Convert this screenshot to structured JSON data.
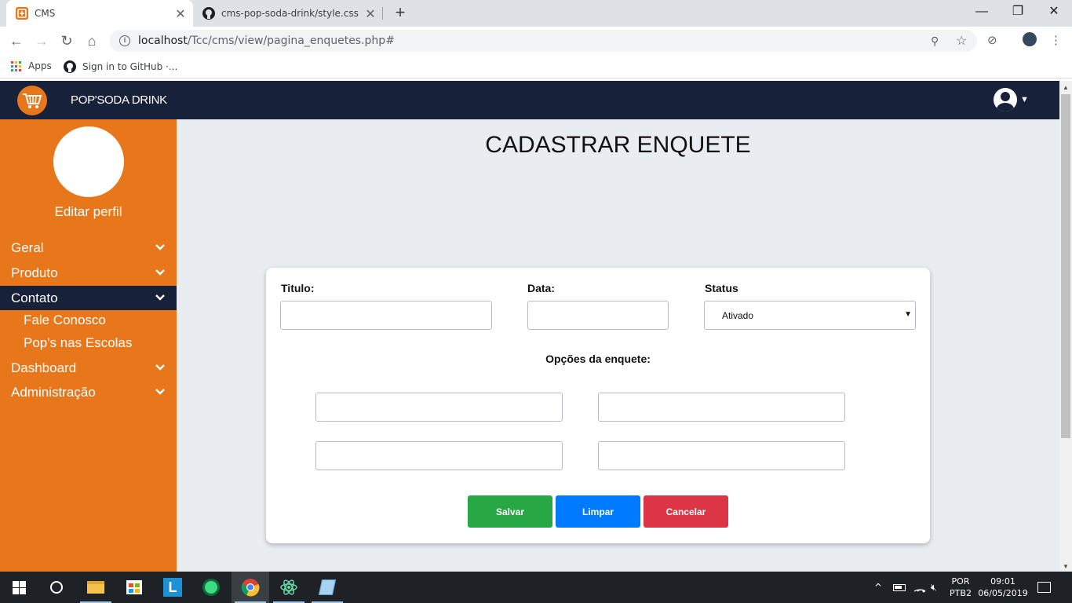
{
  "browser": {
    "tabs": [
      {
        "title": "CMS",
        "active": true
      },
      {
        "title": "cms-pop-soda-drink/style.css at",
        "active": false
      }
    ],
    "url_host": "localhost",
    "url_path": "/Tcc/cms/view/pagina_enquetes.php#",
    "bookmarks": [
      {
        "label": "Apps",
        "icon": "apps-grid-icon"
      },
      {
        "label": "Sign in to GitHub ·...",
        "icon": "github-icon"
      }
    ]
  },
  "header": {
    "brand": "POP'SODA DRINK",
    "brand_color": "#e8761a",
    "nav_bg": "#17213a"
  },
  "sidebar": {
    "edit_profile": "Editar perfil",
    "bg_color": "#e8761a",
    "items": [
      {
        "label": "Geral"
      },
      {
        "label": "Produto"
      },
      {
        "label": "Contato",
        "active": true
      },
      {
        "label": "Dashboard"
      },
      {
        "label": "Administração"
      }
    ],
    "subitems": [
      {
        "label": "Fale Conosco"
      },
      {
        "label": "Pop's nas Escolas"
      }
    ]
  },
  "main": {
    "title": "CADASTRAR ENQUETE",
    "form": {
      "titulo_label": "Titulo:",
      "titulo_value": "",
      "data_label": "Data:",
      "data_value": "",
      "status_label": "Status",
      "status_selected": "Ativado",
      "options_label": "Opções da enquete:",
      "options": [
        "",
        "",
        "",
        ""
      ]
    },
    "buttons": {
      "save": "Salvar",
      "clear": "Limpar",
      "cancel": "Cancelar",
      "save_color": "#28a745",
      "clear_color": "#007bff",
      "cancel_color": "#dc3545"
    }
  },
  "taskbar": {
    "language": "POR",
    "layout": "PTB2",
    "time": "09:01",
    "date": "06/05/2019"
  }
}
